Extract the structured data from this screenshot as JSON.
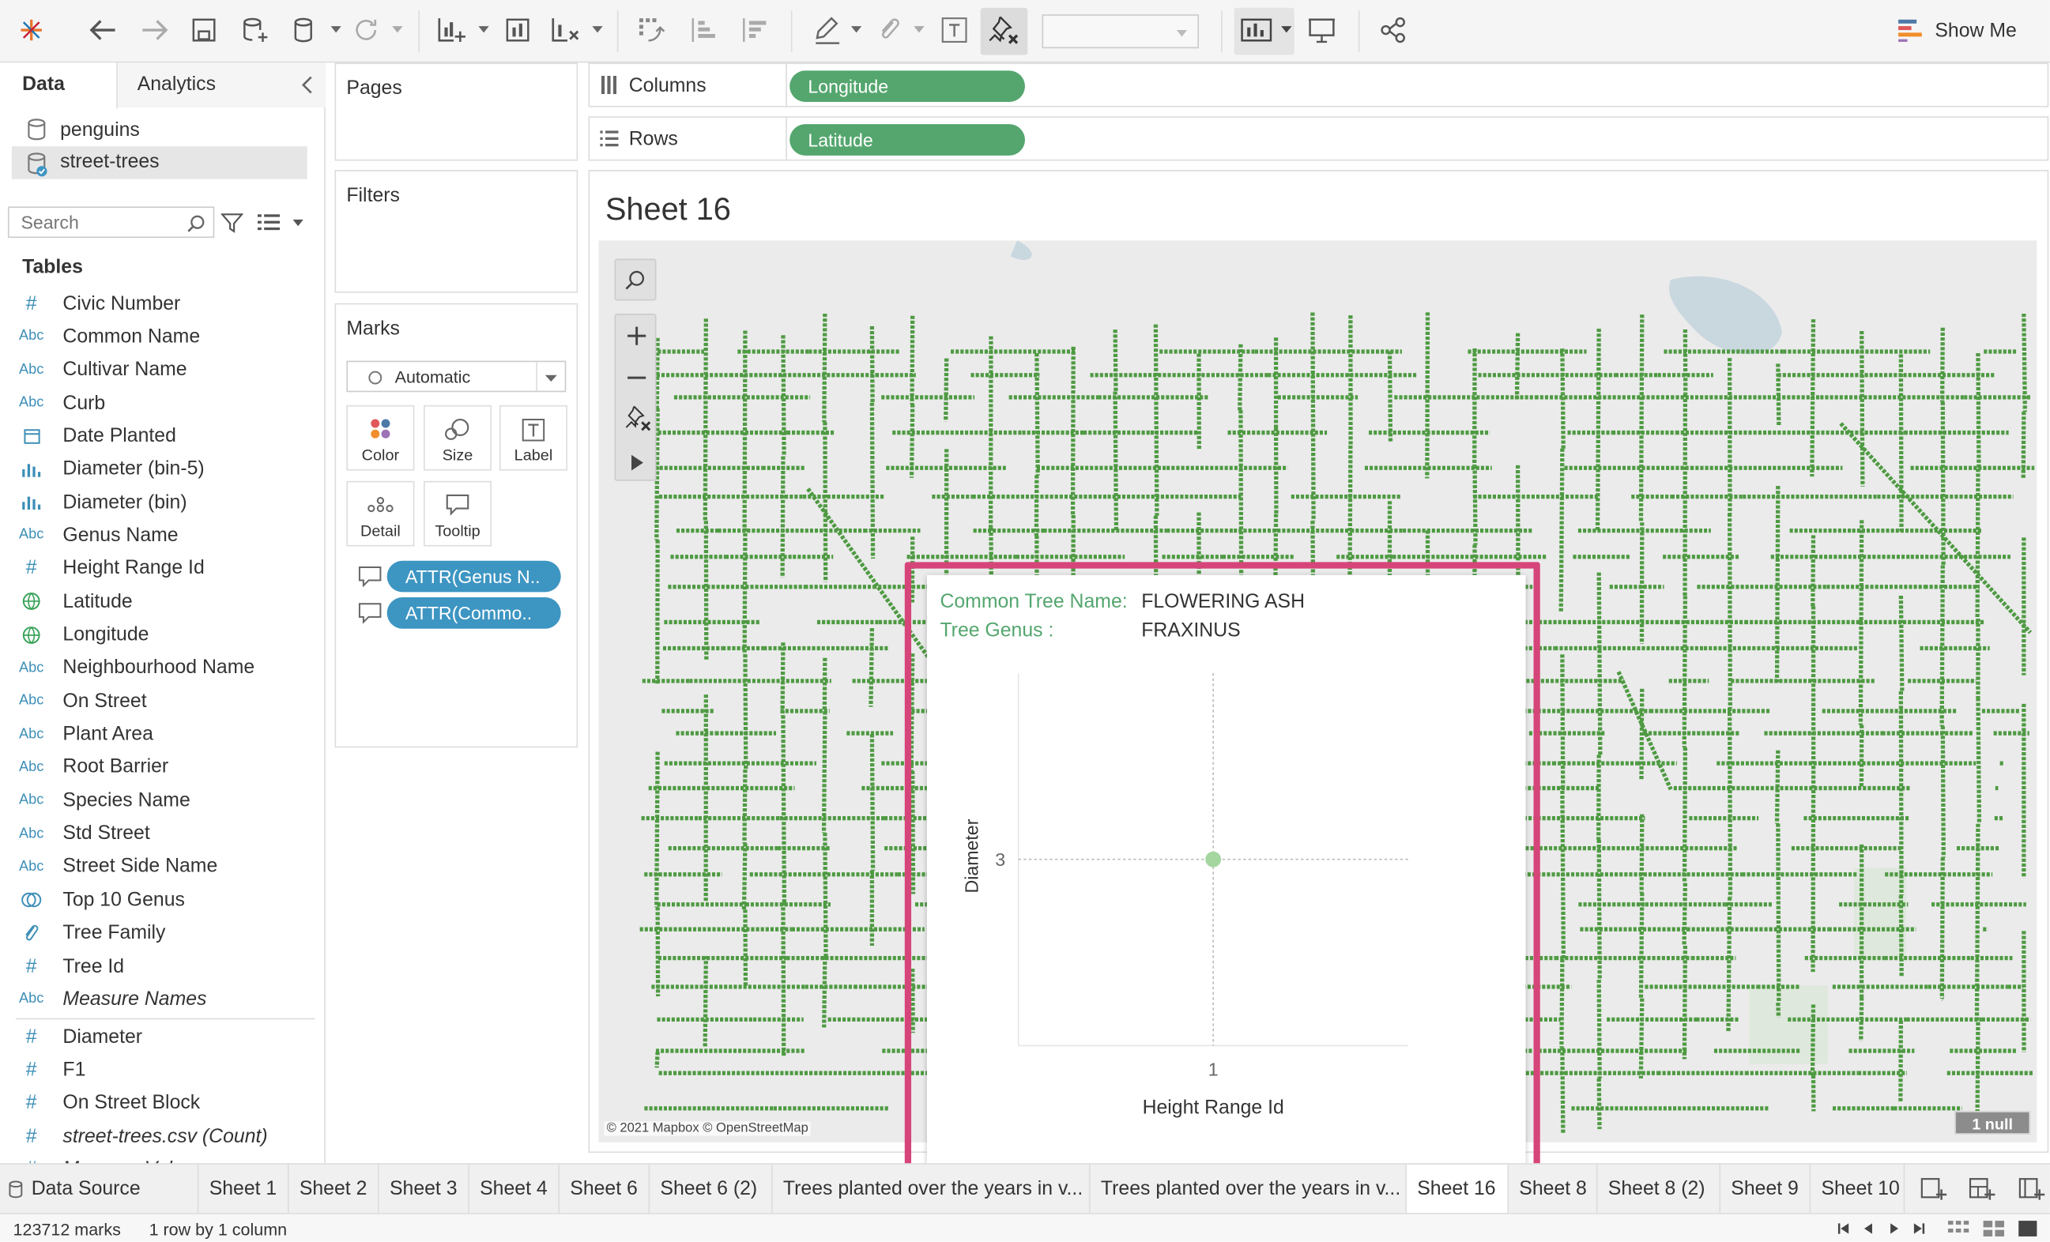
{
  "toolbar": {
    "show_me": "Show Me"
  },
  "panel": {
    "tab_data": "Data",
    "tab_analytics": "Analytics",
    "sources": [
      "penguins",
      "street-trees"
    ],
    "search_placeholder": "Search",
    "tables_heading": "Tables"
  },
  "fields": [
    {
      "type": "#",
      "name": "Civic Number"
    },
    {
      "type": "Abc",
      "name": "Common Name"
    },
    {
      "type": "Abc",
      "name": "Cultivar Name"
    },
    {
      "type": "Abc",
      "name": "Curb"
    },
    {
      "type": "date",
      "name": "Date Planted"
    },
    {
      "type": "bin",
      "name": "Diameter (bin-5)"
    },
    {
      "type": "bin",
      "name": "Diameter (bin)"
    },
    {
      "type": "Abc",
      "name": "Genus Name"
    },
    {
      "type": "#",
      "name": "Height Range Id"
    },
    {
      "type": "geo",
      "name": "Latitude"
    },
    {
      "type": "geo",
      "name": "Longitude"
    },
    {
      "type": "Abc",
      "name": "Neighbourhood Name"
    },
    {
      "type": "Abc",
      "name": "On Street"
    },
    {
      "type": "Abc",
      "name": "Plant Area"
    },
    {
      "type": "Abc",
      "name": "Root Barrier"
    },
    {
      "type": "Abc",
      "name": "Species Name"
    },
    {
      "type": "Abc",
      "name": "Std Street"
    },
    {
      "type": "Abc",
      "name": "Street Side Name"
    },
    {
      "type": "set",
      "name": "Top 10 Genus"
    },
    {
      "type": "clip",
      "name": "Tree Family"
    },
    {
      "type": "#",
      "name": "Tree Id"
    },
    {
      "type": "Abc",
      "name": "Measure Names",
      "italic": true
    }
  ],
  "measures": [
    {
      "type": "#",
      "name": "Diameter"
    },
    {
      "type": "#",
      "name": "F1"
    },
    {
      "type": "#",
      "name": "On Street Block"
    },
    {
      "type": "#",
      "name": "street-trees.csv (Count)",
      "italic": true
    },
    {
      "type": "#",
      "name": "Measure Values",
      "italic": true
    }
  ],
  "cards": {
    "pages": "Pages",
    "filters": "Filters",
    "marks": "Marks",
    "mark_type": "Automatic",
    "color": "Color",
    "size": "Size",
    "label": "Label",
    "detail": "Detail",
    "tooltip": "Tooltip",
    "pills": [
      "ATTR(Genus N..",
      "ATTR(Commo.."
    ]
  },
  "shelves": {
    "columns_label": "Columns",
    "columns_pill": "Longitude",
    "rows_label": "Rows",
    "rows_pill": "Latitude"
  },
  "view": {
    "title": "Sheet 16",
    "attribution": "© 2021 Mapbox © OpenStreetMap",
    "null_badge": "1 null"
  },
  "tooltip": {
    "common_key": "Common Tree Name:",
    "common_val": "FLOWERING ASH",
    "genus_key": "Tree Genus :",
    "genus_val": "FRAXINUS",
    "ylabel": "Diameter",
    "xlabel": "Height Range Id",
    "ytick": "3",
    "xtick": "1"
  },
  "chart_data": {
    "type": "scatter",
    "x": [
      1
    ],
    "y": [
      3
    ],
    "xlabel": "Height Range Id",
    "ylabel": "Diameter"
  },
  "sheets": [
    "Data Source",
    "Sheet 1",
    "Sheet 2",
    "Sheet 3",
    "Sheet 4",
    "Sheet 6",
    "Sheet 6 (2)",
    "Trees planted over the years in v...",
    "Trees planted over the years in v...",
    "Sheet 16",
    "Sheet 8",
    "Sheet 8 (2)",
    "Sheet 9",
    "Sheet 10"
  ],
  "status": {
    "marks": "123712 marks",
    "dims": "1 row by 1 column"
  },
  "colors": {
    "green": "#54a66e",
    "pill_blue": "#3d95c2",
    "map_green": "#4e9a42",
    "highlight": "#d6457a"
  }
}
